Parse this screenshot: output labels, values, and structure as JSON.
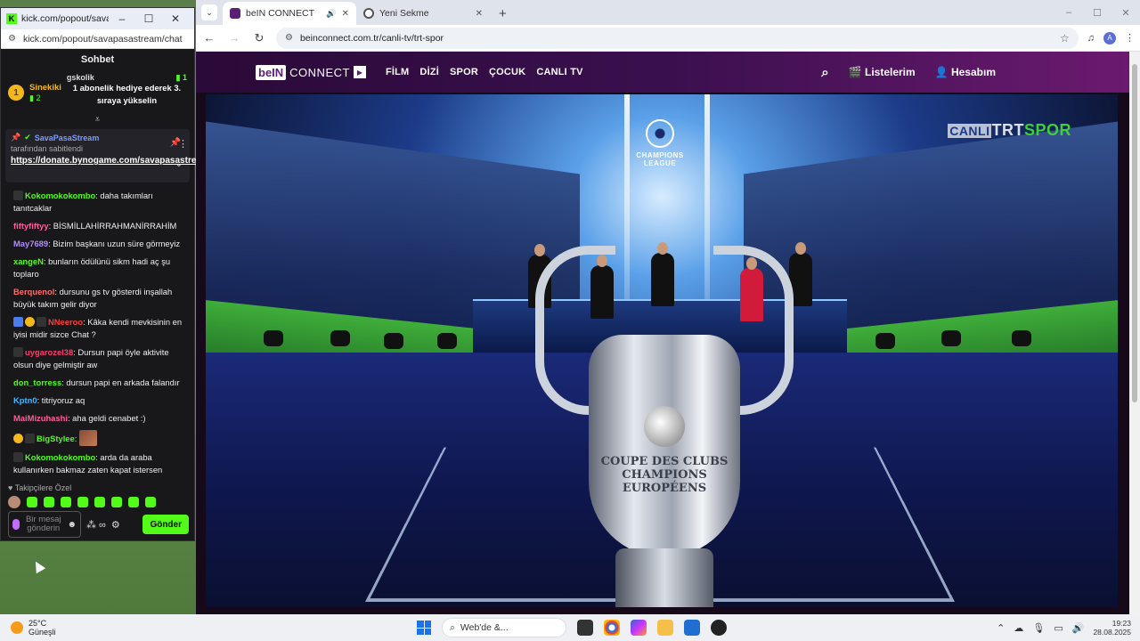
{
  "kick": {
    "window_title": "kick.com/popout/savapasas...",
    "url": "kick.com/popout/savapasastream/chat",
    "chat_title": "Sohbet",
    "leaderboard": {
      "rank": "1",
      "top_user": "Sinekiki",
      "top_count": "2",
      "second_user": "gskolik",
      "second_count": "1",
      "announcement": "1 abonelik hediye ederek 3. sıraya yükselin"
    },
    "pinned": {
      "streamer": "SavaPasaStream",
      "pinned_by": "tarafından sabitlendi",
      "link": "https://donate.bynogame.com/savapasastream"
    },
    "messages": [
      {
        "user": "Kokomokokombo",
        "color": "#53fc18",
        "text": ": daha takımları tanıtcaklar"
      },
      {
        "user": "fiftyfiftyy",
        "color": "#ff5d9e",
        "text": ": BİSMİLLAHİRRAHMANİRRAHİM"
      },
      {
        "user": "May7689",
        "color": "#b08cff",
        "text": ": Bizim başkanı uzun süre görmeyiz"
      },
      {
        "user": "xangeN",
        "color": "#53fc18",
        "text": ": bunların ödülünü sikm hadi aç şu toplaro"
      },
      {
        "user": "Berquenol",
        "color": "#ff6a6a",
        "text": ": dursunu gs tv gösterdi inşallah büyük takım gelir diyor"
      },
      {
        "user": "NNeeroo",
        "color": "#ff3b3b",
        "text": ": Kâka kendi mevkisinin en iyisi midir sizce Chat ?"
      },
      {
        "user": "uygarozel38",
        "color": "#ff3b6b",
        "text": ": Dursun papi öyle aktivite olsun diye gelmiştir aw"
      },
      {
        "user": "don_torress",
        "color": "#53fc18",
        "text": ": dursun papi en arkada falandır"
      },
      {
        "user": "Kptn0",
        "color": "#3fb8ff",
        "text": ": titriyoruz aq"
      },
      {
        "user": "MaiMizuhashi",
        "color": "#ff5d9e",
        "text": ": aha geldi cenabet :)"
      },
      {
        "user": "BigStylee",
        "color": "#53fc18",
        "text": ":"
      },
      {
        "user": "Kokomokokombo",
        "color": "#53fc18",
        "text": ": arda da araba kullanırken bakmaz zaten kapat istersen"
      }
    ],
    "followers_label": "Takipçilere Özel",
    "input_placeholder": "Bir mesaj gönderin",
    "send_label": "Gönder"
  },
  "chrome": {
    "tabs": [
      {
        "label": "beIN CONNECT"
      },
      {
        "label": "Yeni Sekme"
      }
    ],
    "url": "beinconnect.com.tr/canli-tv/trt-spor",
    "profile_initial": "A"
  },
  "bein": {
    "logo_a": "beIN",
    "logo_b": "CONNECT",
    "nav": [
      "FİLM",
      "DİZİ",
      "SPOR",
      "ÇOCUK",
      "CANLI TV"
    ],
    "listelerim": "Listelerim",
    "hesabim": "Hesabım",
    "video": {
      "ucl_line1": "CHAMPIONS",
      "ucl_line2": "LEAGUE",
      "channel_a": "CANLI",
      "channel_b": "TRT",
      "channel_c": "SPOR",
      "engraving1": "COUPE DES CLUBS CHAMPIONS",
      "engraving2": "EUROPÉENS"
    }
  },
  "taskbar": {
    "temp": "25°C",
    "weather": "Güneşli",
    "search_placeholder": "Web'de &...",
    "time": "19:23",
    "date": "28.08.2025"
  }
}
